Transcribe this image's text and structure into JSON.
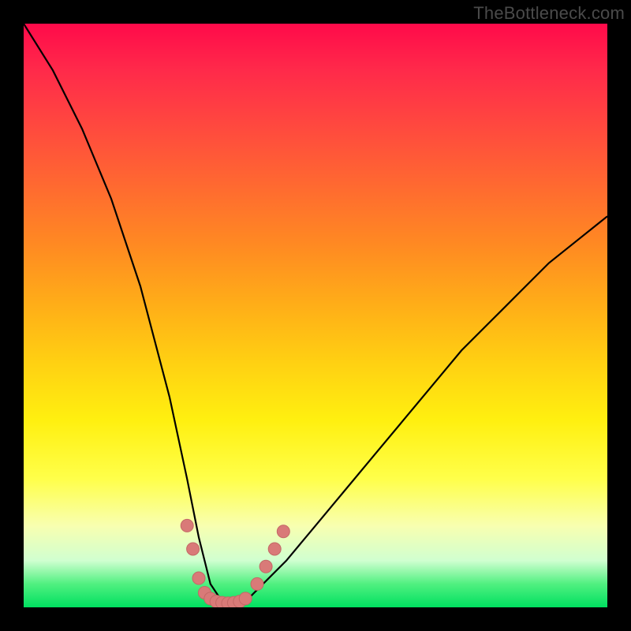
{
  "watermark": {
    "text": "TheBottleneck.com"
  },
  "colors": {
    "curve_stroke": "#000000",
    "marker_fill": "#d97a78",
    "marker_stroke": "#c46866"
  },
  "chart_data": {
    "type": "line",
    "title": "",
    "xlabel": "",
    "ylabel": "",
    "xlim": [
      0,
      100
    ],
    "ylim": [
      0,
      100
    ],
    "grid": false,
    "legend": false,
    "notes": "V-shaped bottleneck curve; y≈0 near x≈35; rises steeply on both sides. Axes are unlabeled so values are relative percentages estimated from pixel positions.",
    "series": [
      {
        "name": "bottleneck-curve",
        "x": [
          0,
          5,
          10,
          15,
          20,
          25,
          28,
          30,
          32,
          34,
          35,
          36,
          38,
          40,
          45,
          50,
          55,
          60,
          65,
          70,
          75,
          80,
          85,
          90,
          95,
          100
        ],
        "y": [
          100,
          92,
          82,
          70,
          55,
          36,
          22,
          12,
          4,
          1,
          0,
          0,
          1,
          3,
          8,
          14,
          20,
          26,
          32,
          38,
          44,
          49,
          54,
          59,
          63,
          67
        ]
      }
    ],
    "markers": {
      "name": "highlight-points",
      "note": "Clustered circular markers near the curve minimum.",
      "points": [
        {
          "x": 28,
          "y": 14
        },
        {
          "x": 29,
          "y": 10
        },
        {
          "x": 30,
          "y": 5
        },
        {
          "x": 31,
          "y": 2.5
        },
        {
          "x": 32,
          "y": 1.5
        },
        {
          "x": 33,
          "y": 1
        },
        {
          "x": 34,
          "y": 0.8
        },
        {
          "x": 35,
          "y": 0.7
        },
        {
          "x": 36,
          "y": 0.8
        },
        {
          "x": 37,
          "y": 1
        },
        {
          "x": 38,
          "y": 1.5
        },
        {
          "x": 40,
          "y": 4
        },
        {
          "x": 41.5,
          "y": 7
        },
        {
          "x": 43,
          "y": 10
        },
        {
          "x": 44.5,
          "y": 13
        }
      ]
    }
  }
}
